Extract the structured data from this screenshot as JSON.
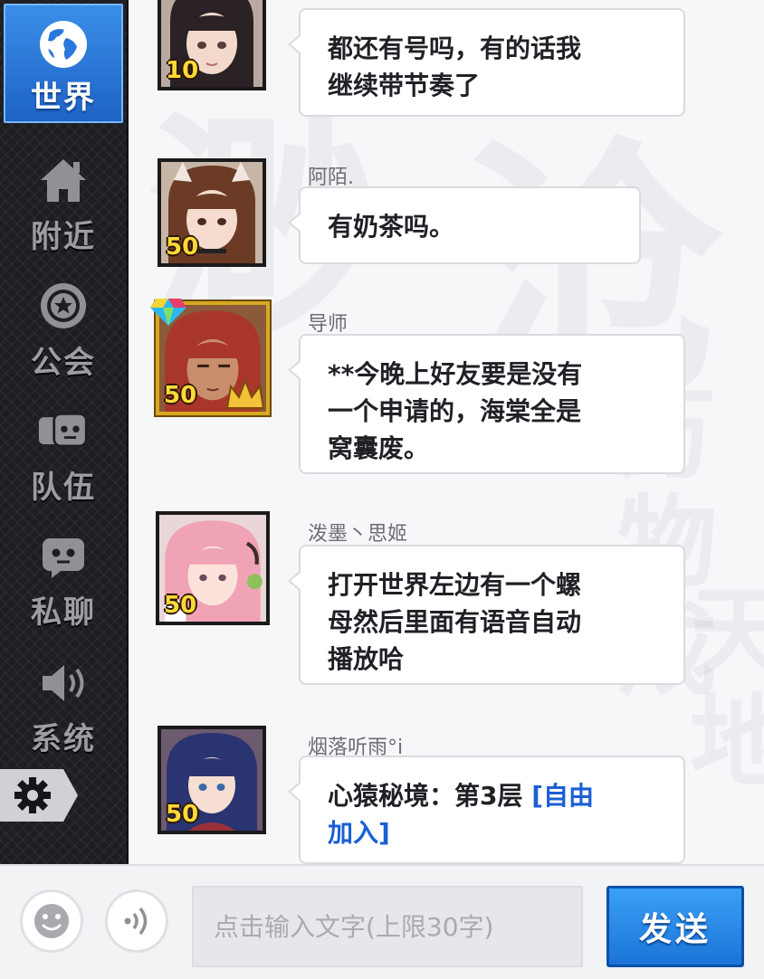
{
  "sidebar": {
    "tabs": [
      {
        "label": "世界",
        "icon": "globe-icon",
        "active": true
      },
      {
        "label": "附近",
        "icon": "home-icon",
        "active": false
      },
      {
        "label": "公会",
        "icon": "guild-emblem-icon",
        "active": false
      },
      {
        "label": "队伍",
        "icon": "team-icon",
        "active": false
      },
      {
        "label": "私聊",
        "icon": "private-chat-icon",
        "active": false
      },
      {
        "label": "系统",
        "icon": "speaker-icon",
        "active": false
      }
    ],
    "settings_icon": "gear-icon"
  },
  "chat": {
    "messages": [
      {
        "username": "",
        "level": "10",
        "text": "都还有号吗，有的话我继续带节奏了",
        "line1": "都还有号吗，有的话我",
        "line2": "继续带节奏了"
      },
      {
        "username": "阿陌.",
        "level": "50",
        "text": "有奶茶吗。"
      },
      {
        "username": "导师",
        "level": "50",
        "line1": "**今晚上好友要是没有",
        "line2": "一个申请的，海棠全是",
        "line3": "窝囊废。"
      },
      {
        "username": "泼墨丶思姬",
        "level": "50",
        "line1": "打开世界左边有一个螺",
        "line2": "母然后里面有语音自动",
        "line3": "播放哈"
      },
      {
        "username": "烟落听雨°i",
        "level": "50",
        "text_prefix": "心猿秘境：第3层 ",
        "link_part1": "[自由",
        "link_part2": "加入]"
      }
    ]
  },
  "input": {
    "placeholder": "点击输入文字(上限30字)",
    "emoji_icon": "smiley-icon",
    "voice_icon": "voice-icon",
    "send_label": "发送"
  },
  "colors": {
    "active_tab": "#2f7fe0",
    "send_button": "#1b74d8",
    "level_text": "#ffd83a",
    "link_text": "#1a5fd6"
  }
}
